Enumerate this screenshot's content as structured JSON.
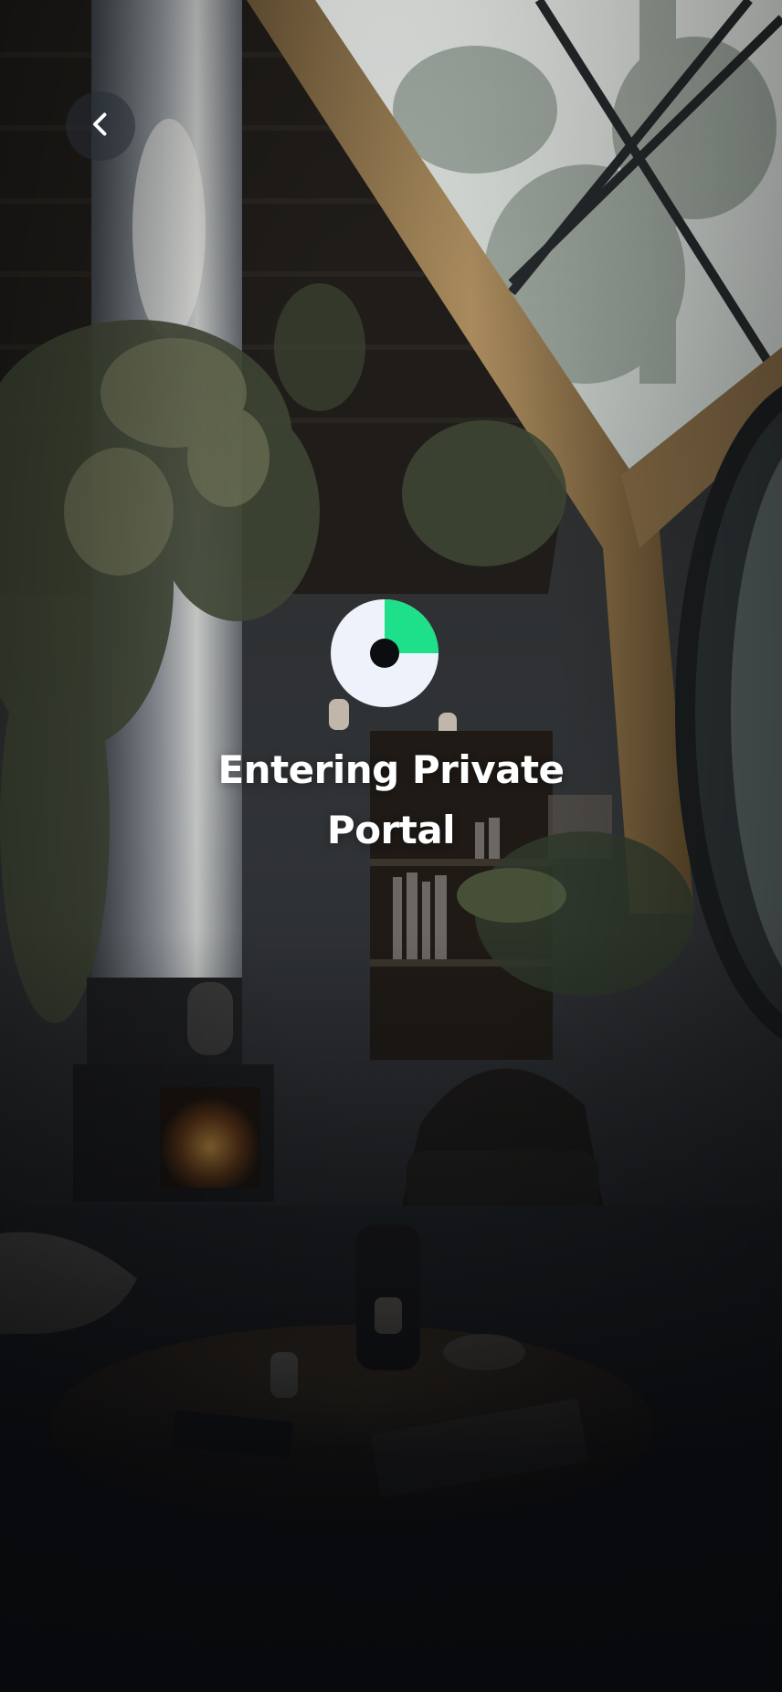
{
  "header": {
    "back_icon": "chevron-left-icon"
  },
  "loader": {
    "icon": "progress-ring-icon",
    "progress_fraction": 0.25,
    "progress_color": "#1fe08a",
    "track_color": "#eef2fb",
    "hole_color": "#0b0d10"
  },
  "main": {
    "title": "Entering Private Portal"
  },
  "colors": {
    "background_dark": "#08090c",
    "text": "#ffffff"
  }
}
